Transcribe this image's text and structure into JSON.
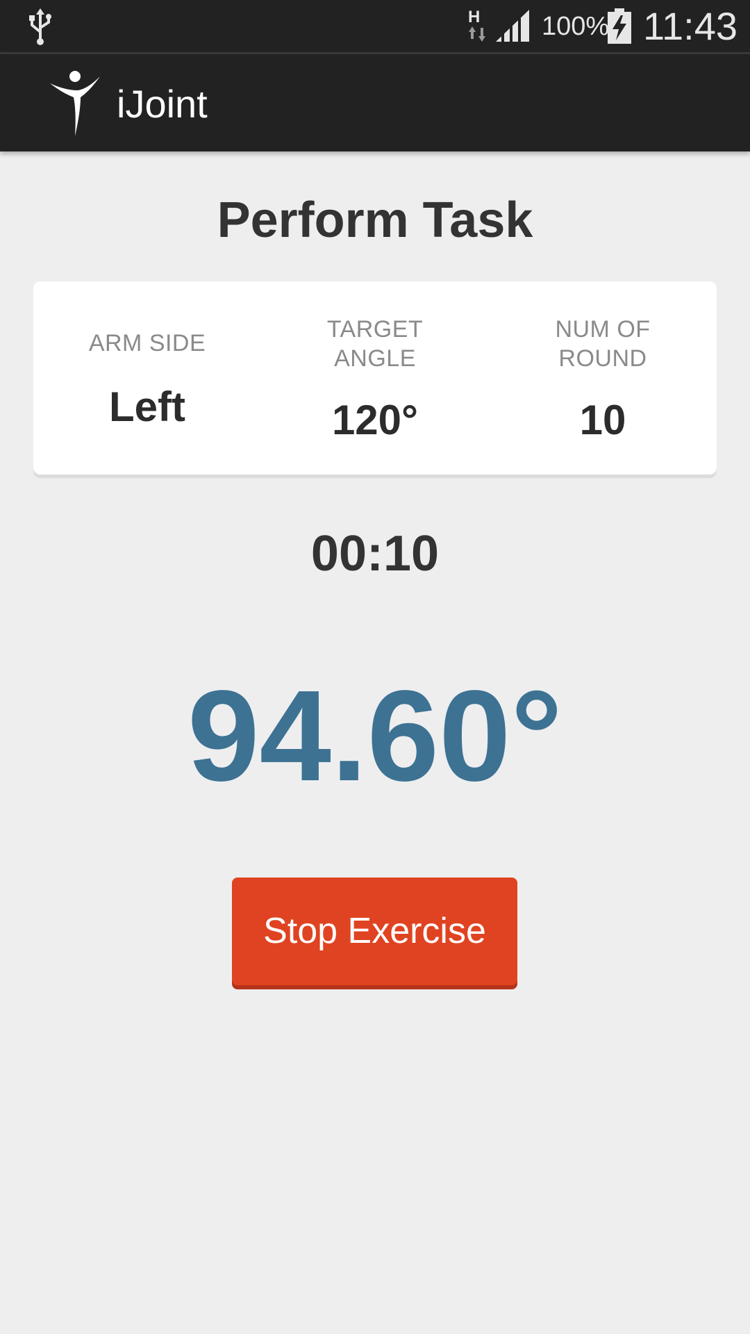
{
  "status_bar": {
    "usb_icon": "usb-icon",
    "network_type": "H",
    "signal_icon": "signal-icon",
    "battery_percent": "100%",
    "battery_icon": "battery-charging-icon",
    "time": "11:43"
  },
  "app_bar": {
    "logo_icon": "ijoint-logo-icon",
    "title": "iJoint"
  },
  "page": {
    "title": "Perform Task"
  },
  "info": {
    "arm_side": {
      "label": "ARM SIDE",
      "value": "Left"
    },
    "target_angle": {
      "label_line1": "TARGET",
      "label_line2": "ANGLE",
      "value": "120°"
    },
    "num_of_round": {
      "label_line1": "NUM OF",
      "label_line2": "ROUND",
      "value": "10"
    }
  },
  "exercise": {
    "timer": "00:10",
    "current_angle": "94.60°",
    "stop_label": "Stop Exercise"
  },
  "colors": {
    "background": "#eeeeef",
    "bar": "#222222",
    "angle_text": "#3d7293",
    "stop_button": "#e04321"
  }
}
